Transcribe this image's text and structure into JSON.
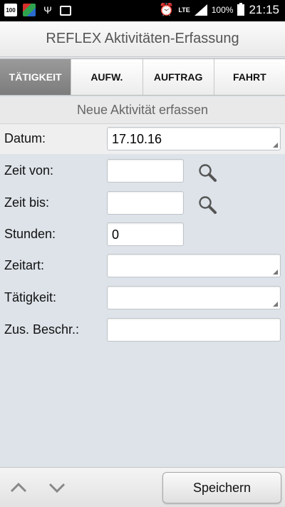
{
  "status_bar": {
    "notification_badge": "100",
    "network": "LTE",
    "battery": "100%",
    "time": "21:15"
  },
  "app": {
    "title": "REFLEX Aktivitäten-Erfassung"
  },
  "tabs": [
    {
      "label": "TÄTIGKEIT",
      "active": true
    },
    {
      "label": "AUFW.",
      "active": false
    },
    {
      "label": "AUFTRAG",
      "active": false
    },
    {
      "label": "FAHRT",
      "active": false
    }
  ],
  "section": {
    "title": "Neue Aktivität erfassen"
  },
  "form": {
    "datum": {
      "label": "Datum:",
      "value": "17.10.16"
    },
    "zeit_von": {
      "label": "Zeit von:",
      "value": ""
    },
    "zeit_bis": {
      "label": "Zeit bis:",
      "value": ""
    },
    "stunden": {
      "label": "Stunden:",
      "value": "0"
    },
    "zeitart": {
      "label": "Zeitart:",
      "value": ""
    },
    "taetigkeit": {
      "label": "Tätigkeit:",
      "value": ""
    },
    "zus_beschr": {
      "label": "Zus. Beschr.:",
      "value": ""
    }
  },
  "bottom_bar": {
    "save_label": "Speichern"
  },
  "icons": {
    "search": "magnifier-icon",
    "prev": "chevron-up-icon",
    "next": "chevron-down-icon"
  },
  "colors": {
    "active_tab": "#8a8a8a",
    "form_background": "#dde3e9"
  }
}
